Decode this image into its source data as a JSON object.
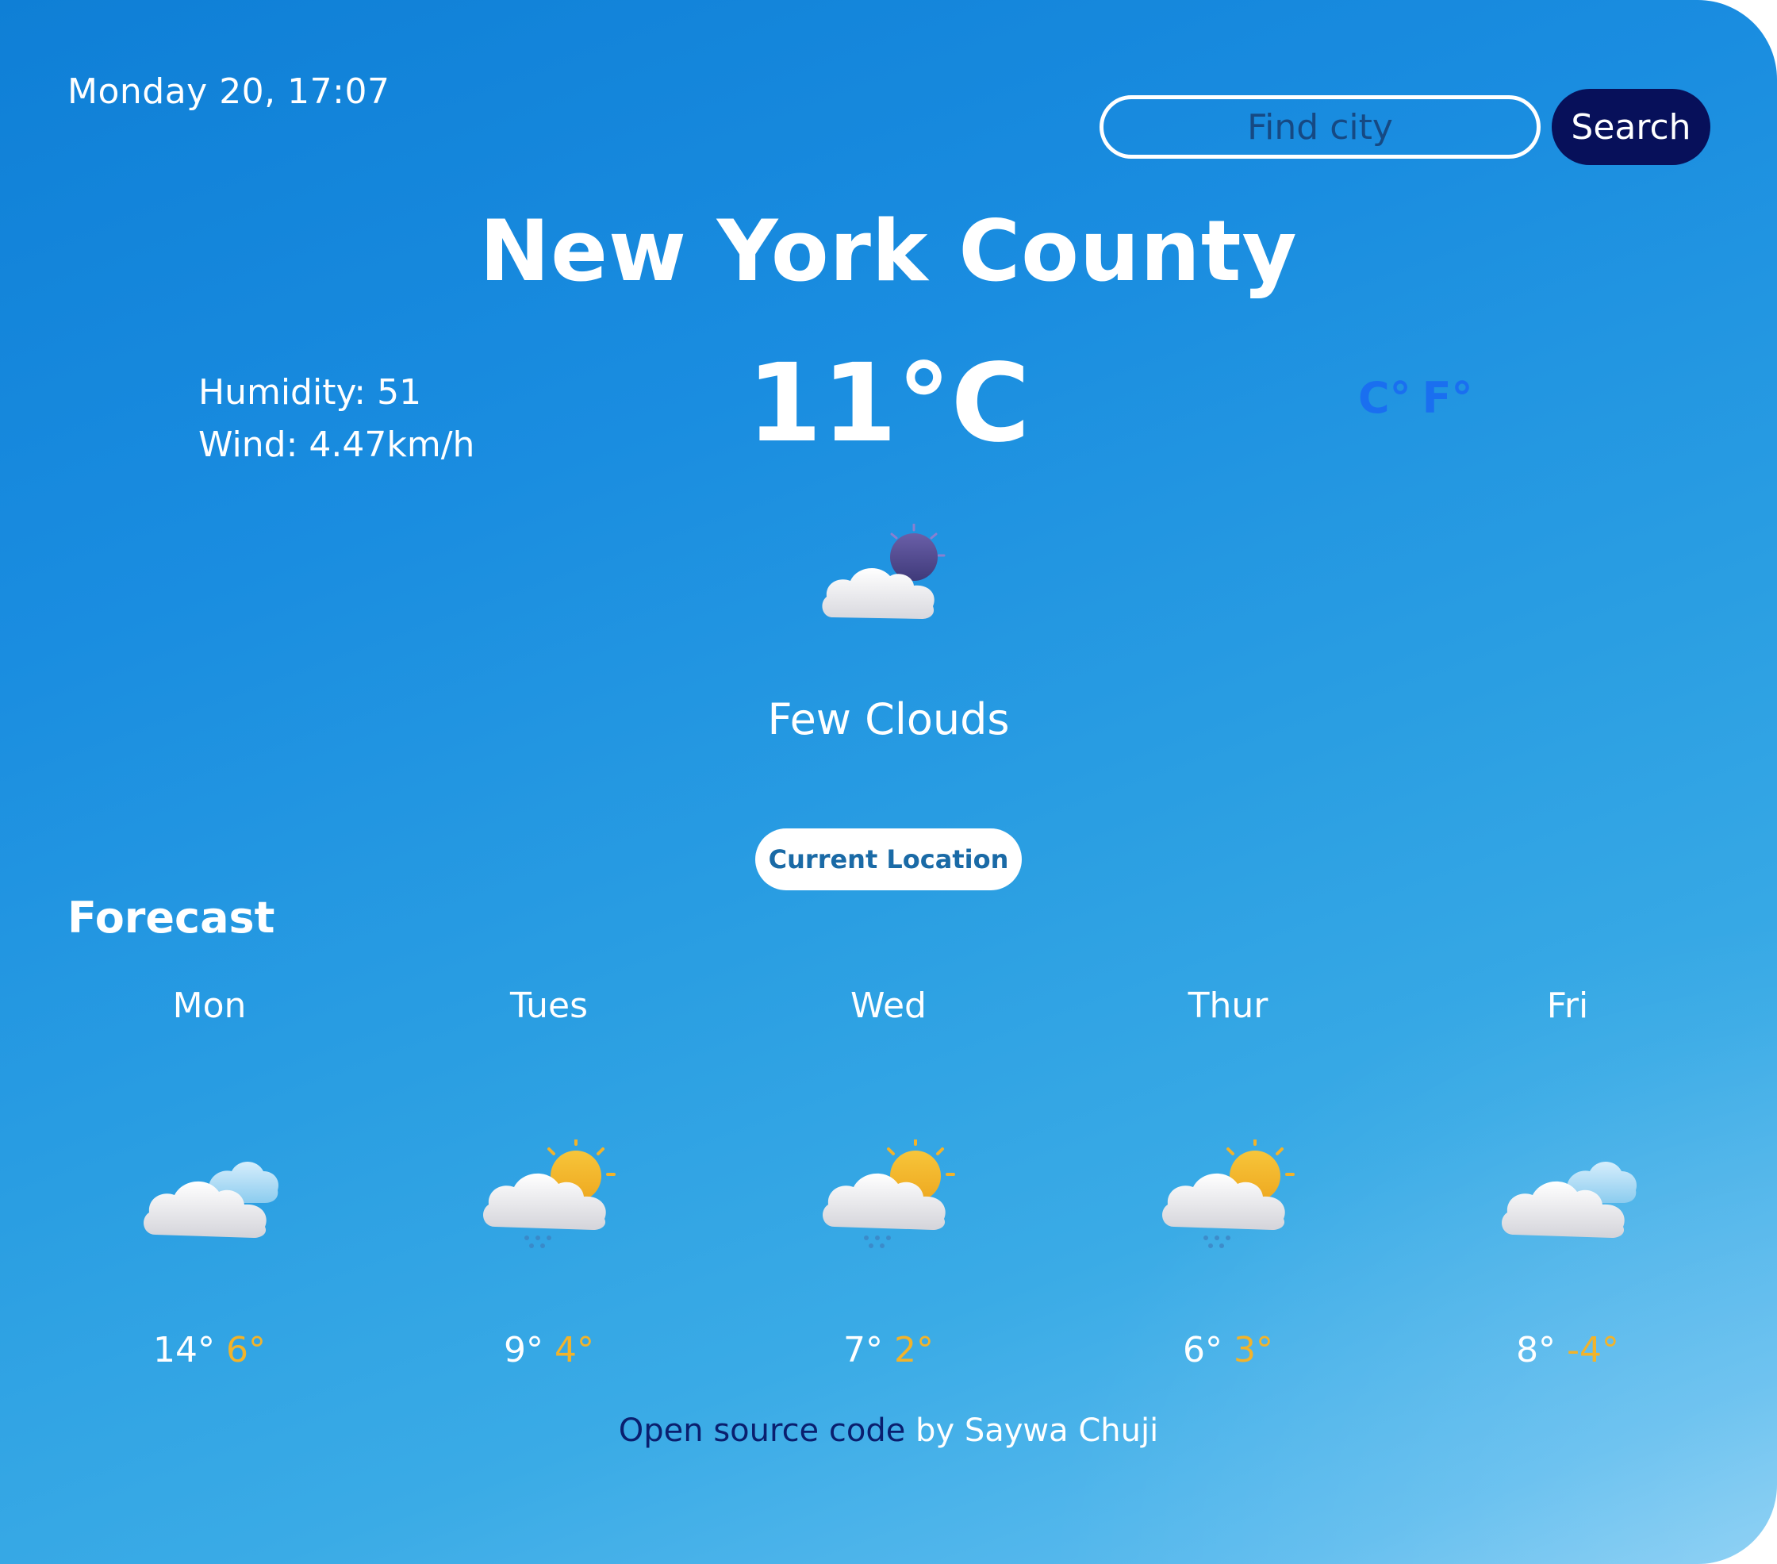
{
  "header": {
    "datetime": "Monday 20, 17:07"
  },
  "search": {
    "placeholder": "Find city",
    "value": "",
    "button_label": "Search"
  },
  "current": {
    "city": "New York County",
    "humidity": "Humidity: 51",
    "wind": "Wind: 4.47km/h",
    "temperature": "11°C",
    "description": "Few Clouds",
    "icon": "few-clouds-night-icon"
  },
  "units": {
    "celsius": "C°",
    "fahrenheit": "F°",
    "color": "#1a6ff0"
  },
  "location_button": "Current Location",
  "forecast": {
    "title": "Forecast",
    "days": [
      {
        "day": "Mon",
        "max": "14°",
        "min": "6°",
        "icon": "cloudy-icon"
      },
      {
        "day": "Tues",
        "max": "9°",
        "min": "4°",
        "icon": "sun-rain-icon"
      },
      {
        "day": "Wed",
        "max": "7°",
        "min": "2°",
        "icon": "sun-rain-icon"
      },
      {
        "day": "Thur",
        "max": "6°",
        "min": "3°",
        "icon": "sun-rain-icon"
      },
      {
        "day": "Fri",
        "max": "8°",
        "min": "-4°",
        "icon": "cloudy-icon"
      }
    ]
  },
  "footer": {
    "link_text": "Open source code",
    "by_text": " by Saywa Chuji"
  },
  "colors": {
    "search_button": "#07105a",
    "min_temp": "#f2b32a",
    "footer_link": "#0a1f6e"
  }
}
